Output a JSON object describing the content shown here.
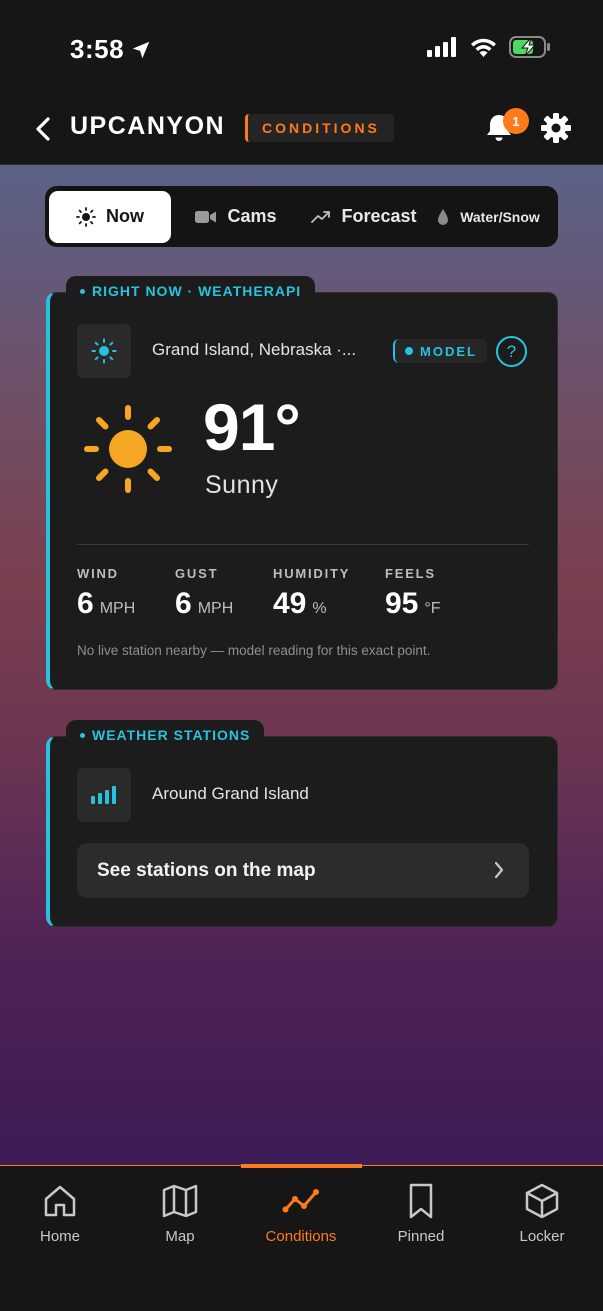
{
  "status_bar": {
    "time": "3:58"
  },
  "header": {
    "brand": "UPCANYON",
    "section": "CONDITIONS",
    "notification_count": "1"
  },
  "tabs": [
    {
      "label": "Now",
      "icon": "sun-icon",
      "active": true
    },
    {
      "label": "Cams",
      "icon": "camera-icon",
      "active": false
    },
    {
      "label": "Forecast",
      "icon": "trend-icon",
      "active": false
    },
    {
      "label": "Water/Snow",
      "icon": "drop-icon",
      "active": false
    }
  ],
  "current": {
    "tag": "RIGHT NOW · WEATHERAPI",
    "location": "Grand Island, Nebraska ·...",
    "source_badge": "MODEL",
    "help": "?",
    "temperature": "91°",
    "condition": "Sunny",
    "metrics": [
      {
        "label": "WIND",
        "value": "6",
        "unit": "MPH"
      },
      {
        "label": "GUST",
        "value": "6",
        "unit": "MPH"
      },
      {
        "label": "HUMIDITY",
        "value": "49",
        "unit": "%"
      },
      {
        "label": "FEELS",
        "value": "95",
        "unit": "°F"
      }
    ],
    "note": "No live station nearby — model reading for this exact point."
  },
  "stations": {
    "tag": "WEATHER STATIONS",
    "area": "Around Grand Island",
    "map_button": "See stations on the map"
  },
  "bottom_nav": [
    {
      "label": "Home",
      "icon": "home-icon",
      "active": false
    },
    {
      "label": "Map",
      "icon": "map-icon",
      "active": false
    },
    {
      "label": "Conditions",
      "icon": "conditions-icon",
      "active": true
    },
    {
      "label": "Pinned",
      "icon": "bookmark-icon",
      "active": false
    },
    {
      "label": "Locker",
      "icon": "box-icon",
      "active": false
    }
  ],
  "colors": {
    "accent": "#ff7a1a",
    "info": "#27c3de",
    "sun": "#f5a623",
    "background": "#161616"
  }
}
